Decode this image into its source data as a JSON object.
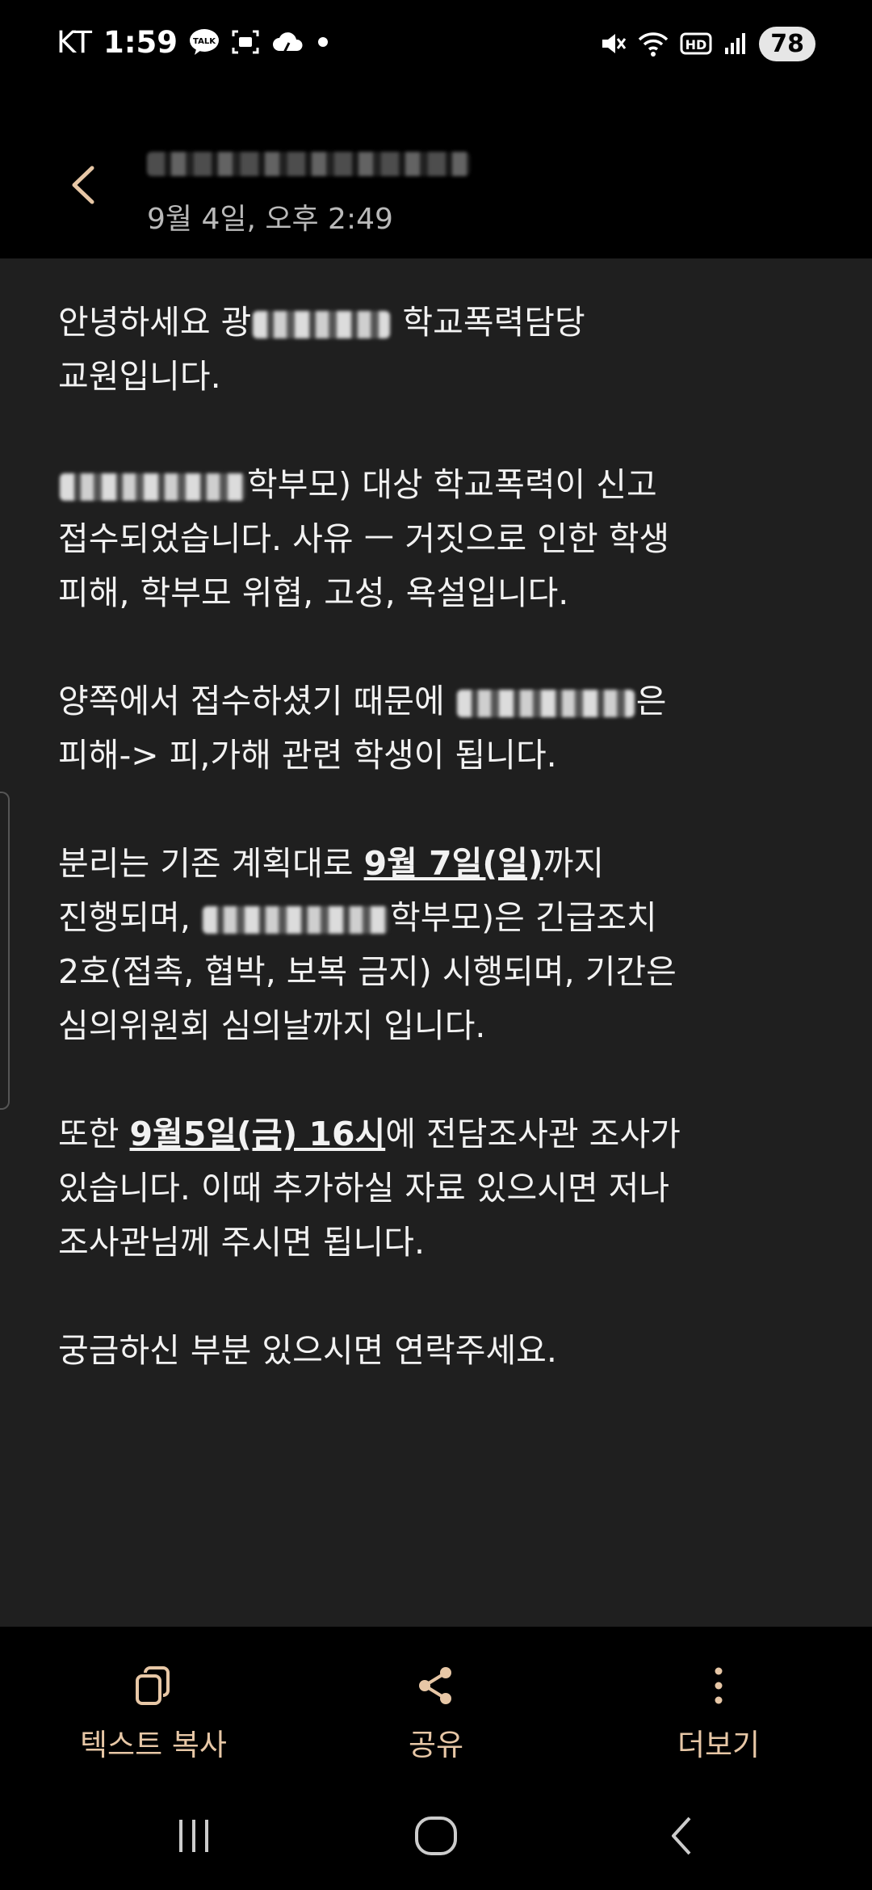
{
  "status_bar": {
    "carrier": "KT",
    "time": "1:59",
    "battery": "78",
    "icons_left": [
      "talk-icon",
      "screenshot-icon",
      "cloud-icon",
      "dot-icon"
    ],
    "icons_right": [
      "mute-icon",
      "wifi-icon",
      "hd-icon",
      "signal-icon"
    ]
  },
  "header": {
    "date": "9월 4일, 오후 2:49"
  },
  "message": {
    "p1_a": "안녕하세요 광",
    "p1_b": "학교폭력담당",
    "p1_c": "교원입니다.",
    "p2_a": "학부모) 대상 학교폭력이 신고",
    "p2_b": "접수되었습니다. 사유 ㅡ 거짓으로 인한 학생",
    "p2_c": "피해, 학부모 위협, 고성, 욕설입니다.",
    "p3_a": "양쪽에서 접수하셨기 때문에",
    "p3_b": "은",
    "p3_c": "피해-> 피,가해 관련 학생이 됩니다.",
    "p4_a": "분리는 기존 계획대로",
    "p4_date": "9월 7일(일)",
    "p4_b": "까지",
    "p4_c": "진행되며,",
    "p4_d": "학부모)은 긴급조치",
    "p4_e": "2호(접촉,  협박, 보복 금지) 시행되며, 기간은",
    "p4_f": "심의위원회 심의날까지 입니다.",
    "p5_a": "또한",
    "p5_date": "9월5일(금) 16시",
    "p5_b": "에 전담조사관 조사가",
    "p5_c": "있습니다. 이때 추가하실 자료 있으시면 저나",
    "p5_d": "조사관님께 주시면 됩니다.",
    "p6": "궁금하신 부분 있으시면 연락주세요."
  },
  "actions": {
    "copy": "텍스트 복사",
    "share": "공유",
    "more": "더보기"
  },
  "colors": {
    "background": "#000000",
    "content_bg": "#1f1f1f",
    "accent_label": "#e7c7a6"
  }
}
